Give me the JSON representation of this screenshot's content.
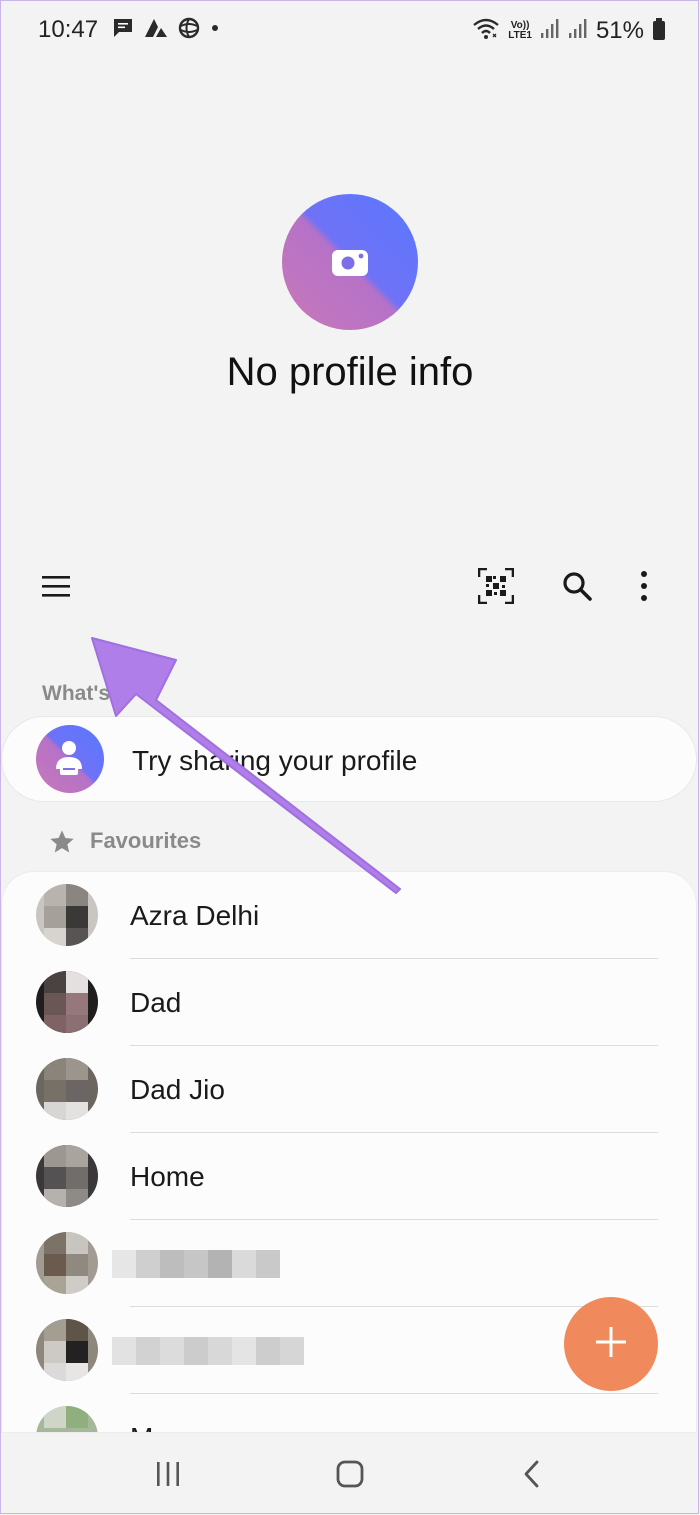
{
  "status_bar": {
    "time": "10:47",
    "left_icons": [
      "message-icon",
      "app-notification-icon",
      "globe-icon",
      "dot-icon"
    ],
    "right_icons": [
      "wifi-icon",
      "volte-icon",
      "signal-icon",
      "signal-icon",
      "battery-icon"
    ],
    "volte_top": "Vo))",
    "volte_bottom": "LTE1",
    "battery": "51%"
  },
  "profile": {
    "status": "No profile info",
    "avatar_icon": "camera-icon"
  },
  "toolbar": {
    "menu_icon": "hamburger-menu-icon",
    "qr_icon": "qr-code-icon",
    "search_icon": "search-icon",
    "more_icon": "more-vertical-icon"
  },
  "whats_new": {
    "label": "What's",
    "share_text": "Try sharing your profile"
  },
  "favourites": {
    "label": "Favourites",
    "contacts": [
      {
        "name": "Azra Delhi"
      },
      {
        "name": "Dad"
      },
      {
        "name": "Dad Jio"
      },
      {
        "name": "Home"
      },
      {
        "name": ""
      },
      {
        "name": ""
      },
      {
        "name": "Mom"
      }
    ]
  },
  "fab": {
    "icon": "plus-icon"
  },
  "nav_bar": {
    "recents_icon": "recents-icon",
    "home_icon": "home-icon",
    "back_icon": "back-icon"
  },
  "colors": {
    "background": "#f3f3f3",
    "accent_gradient_start": "#5a78ff",
    "accent_gradient_end": "#c878b8",
    "fab": "#f08a5d",
    "annotation_arrow": "#b07ee8"
  }
}
